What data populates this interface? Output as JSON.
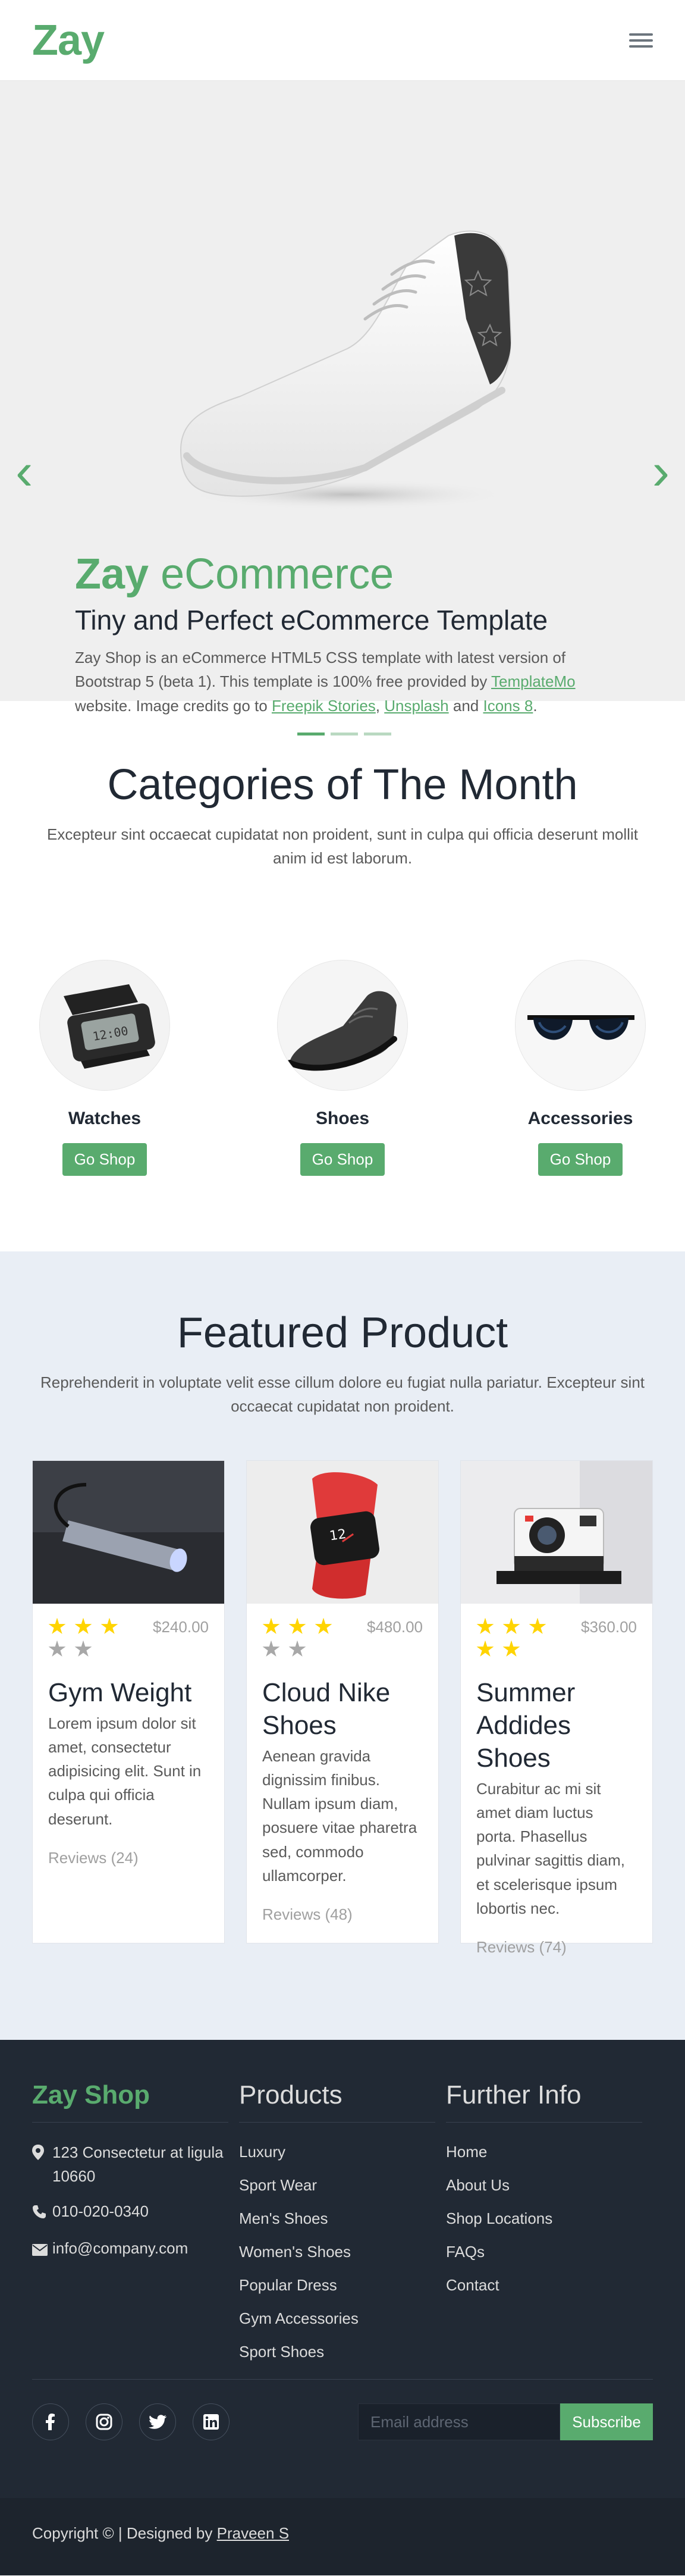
{
  "header": {
    "brand": "Zay"
  },
  "hero": {
    "title_bold": "Zay",
    "title_light": "eCommerce",
    "subtitle": "Tiny and Perfect eCommerce Template",
    "desc_part1": "Zay Shop is an eCommerce HTML5 CSS template with latest version of Bootstrap 5 (beta 1). This template is 100% free provided by ",
    "link_templatemo": "TemplateMo",
    "desc_part2": " website. Image credits go to ",
    "link_freepik": "Freepik Stories",
    "sep1": ", ",
    "link_unsplash": "Unsplash",
    "sep2": " and ",
    "link_icons8": "Icons 8",
    "end": ".",
    "slide_count": 3,
    "active_slide": 1
  },
  "categories": {
    "title": "Categories of The Month",
    "desc": "Excepteur sint occaecat cupidatat non proident, sunt in culpa qui officia deserunt mollit anim id est laborum.",
    "items": [
      {
        "name": "Watches",
        "button": "Go Shop"
      },
      {
        "name": "Shoes",
        "button": "Go Shop"
      },
      {
        "name": "Accessories",
        "button": "Go Shop"
      }
    ]
  },
  "featured": {
    "title": "Featured Product",
    "desc": "Reprehenderit in voluptate velit esse cillum dolore eu fugiat nulla pariatur. Excepteur sint occaecat cupidatat non proident.",
    "products": [
      {
        "title": "Gym Weight",
        "price": "$240.00",
        "rating": 3,
        "text": "Lorem ipsum dolor sit amet, consectetur adipisicing elit. Sunt in culpa qui officia deserunt.",
        "reviews": "Reviews (24)"
      },
      {
        "title": "Cloud Nike Shoes",
        "price": "$480.00",
        "rating": 3,
        "text": "Aenean gravida dignissim finibus. Nullam ipsum diam, posuere vitae pharetra sed, commodo ullamcorper.",
        "reviews": "Reviews (48)"
      },
      {
        "title": "Summer Addides Shoes",
        "price": "$360.00",
        "rating": 5,
        "text": "Curabitur ac mi sit amet diam luctus porta. Phasellus pulvinar sagittis diam, et scelerisque ipsum lobortis nec.",
        "reviews": "Reviews (74)"
      }
    ]
  },
  "footer": {
    "brand": "Zay Shop",
    "address": "123 Consectetur at ligula 10660",
    "phone": "010-020-0340",
    "email": "info@company.com",
    "products_title": "Products",
    "products": [
      "Luxury",
      "Sport Wear",
      "Men's Shoes",
      "Women's Shoes",
      "Popular Dress",
      "Gym Accessories",
      "Sport Shoes"
    ],
    "info_title": "Further Info",
    "info": [
      "Home",
      "About Us",
      "Shop Locations",
      "FAQs",
      "Contact"
    ],
    "socials": [
      "facebook-icon",
      "instagram-icon",
      "twitter-icon",
      "linkedin-icon"
    ],
    "email_placeholder": "Email address",
    "subscribe_label": "Subscribe",
    "copyright": "Copyright © | Designed by ",
    "designer": "Praveen S"
  },
  "colors": {
    "accent": "#59ab6e",
    "footer_bg": "#212934",
    "star": "#ffd400"
  }
}
